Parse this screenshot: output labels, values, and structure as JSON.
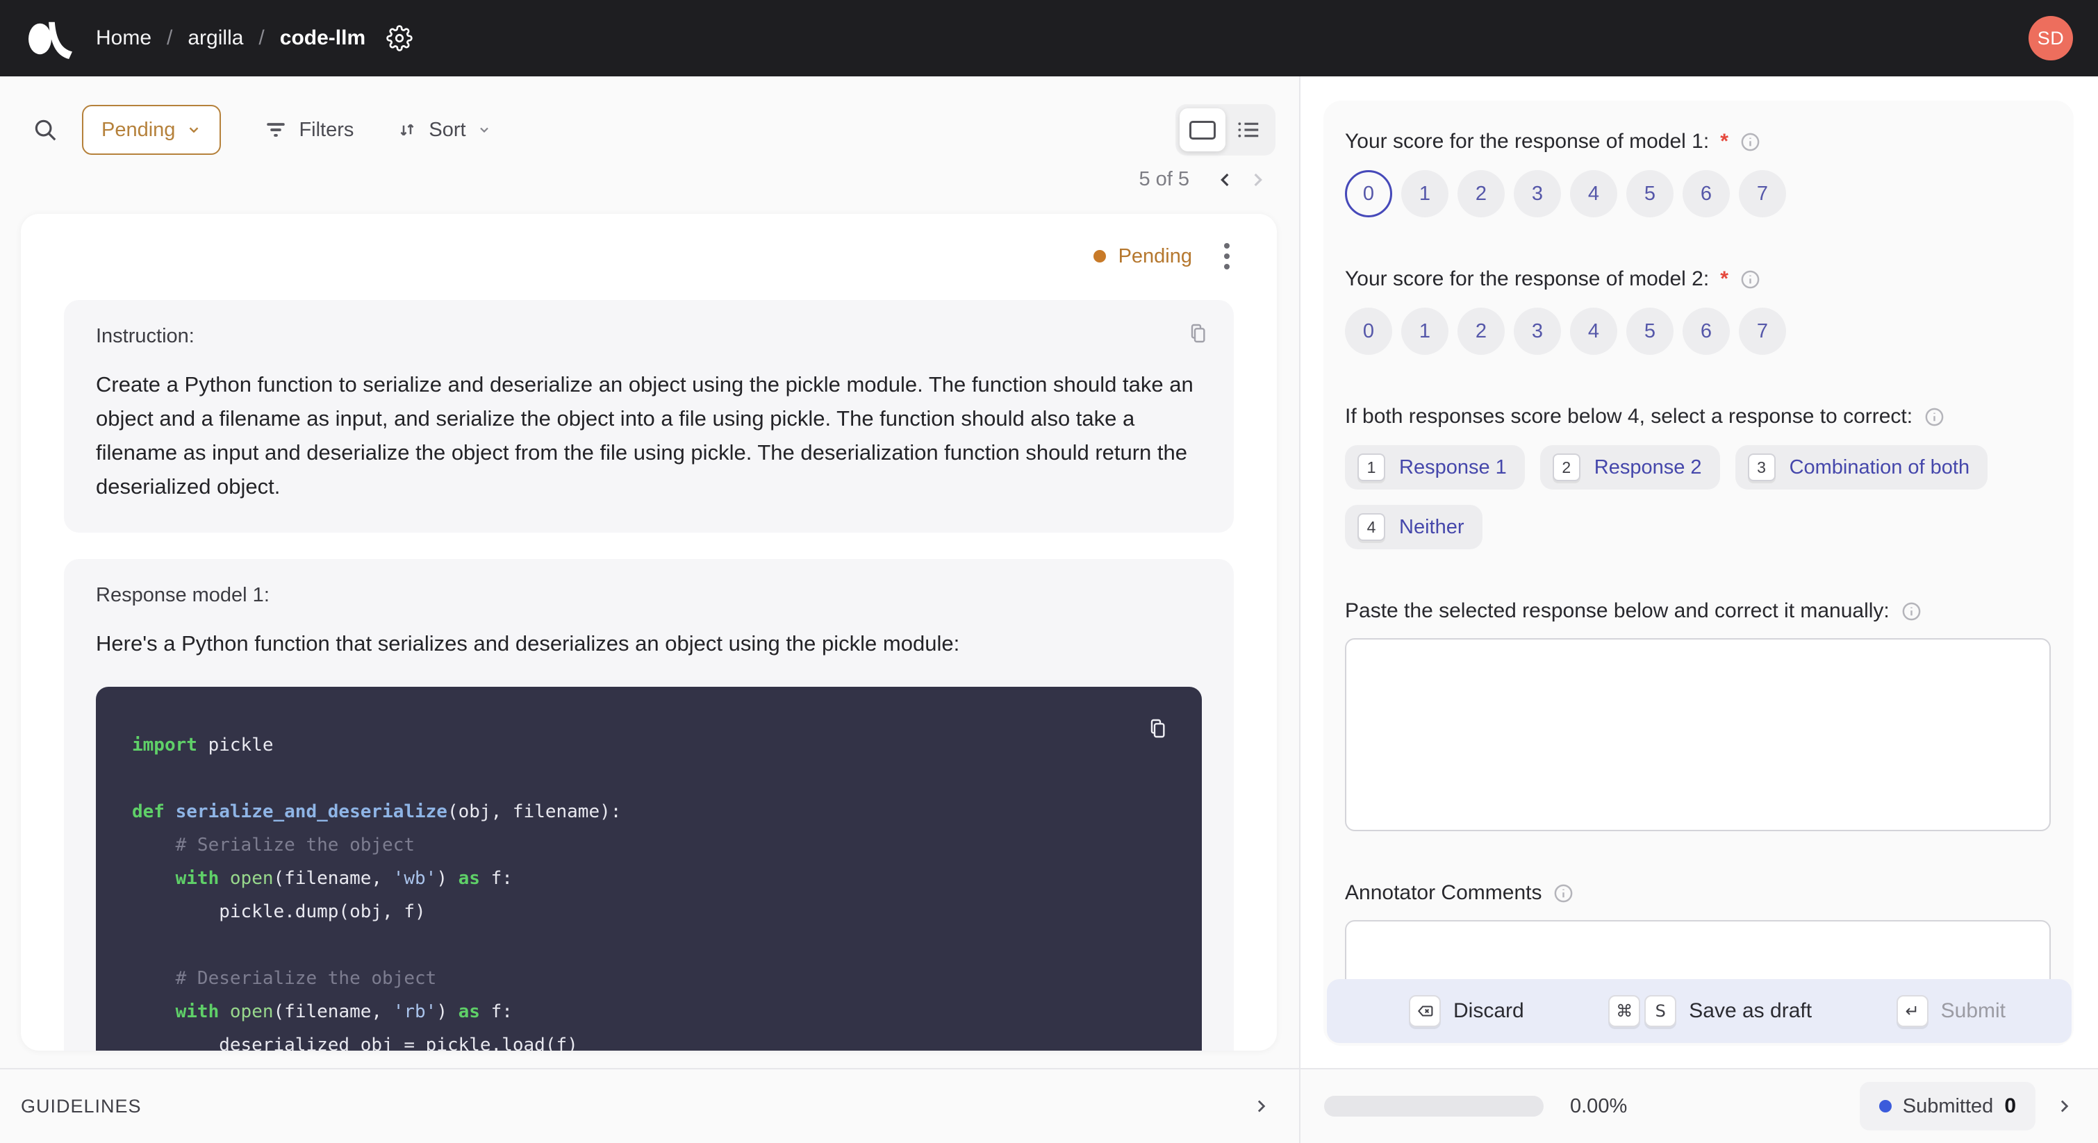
{
  "nav": {
    "breadcrumb": [
      {
        "label": "Home"
      },
      {
        "label": "argilla"
      },
      {
        "label": "code-llm"
      }
    ],
    "separator": "/",
    "avatar_initials": "SD"
  },
  "toolbar": {
    "status_filter_label": "Pending",
    "filters_label": "Filters",
    "sort_label": "Sort",
    "pagination": "5 of 5"
  },
  "record": {
    "status_label": "Pending",
    "instruction": {
      "title": "Instruction:",
      "text": "Create a Python function to serialize and deserialize an object using the pickle module. The function should take an object and a filename as input, and serialize the object into a file using pickle. The function should also take a filename as input and deserialize the object from the file using pickle. The deserialization function should return the deserialized object."
    },
    "response": {
      "title": "Response model 1:",
      "intro": "Here's a Python function that serializes and deserializes an object using the pickle module:"
    },
    "code_lines": [
      [
        {
          "t": "import",
          "c": "kw"
        },
        {
          "t": " pickle",
          "c": "pl"
        }
      ],
      [],
      [
        {
          "t": "def",
          "c": "kw"
        },
        {
          "t": " ",
          "c": "pl"
        },
        {
          "t": "serialize_and_deserialize",
          "c": "fn"
        },
        {
          "t": "(obj, filename):",
          "c": "pl"
        }
      ],
      [
        {
          "t": "    ",
          "c": "pl"
        },
        {
          "t": "# Serialize the object",
          "c": "cm"
        }
      ],
      [
        {
          "t": "    ",
          "c": "pl"
        },
        {
          "t": "with",
          "c": "kw"
        },
        {
          "t": " ",
          "c": "pl"
        },
        {
          "t": "open",
          "c": "bi"
        },
        {
          "t": "(filename, ",
          "c": "pl"
        },
        {
          "t": "'wb'",
          "c": "st"
        },
        {
          "t": ") ",
          "c": "pl"
        },
        {
          "t": "as",
          "c": "kw"
        },
        {
          "t": " f:",
          "c": "pl"
        }
      ],
      [
        {
          "t": "        pickle.dump(obj, f)",
          "c": "pl"
        }
      ],
      [],
      [
        {
          "t": "    ",
          "c": "pl"
        },
        {
          "t": "# Deserialize the object",
          "c": "cm"
        }
      ],
      [
        {
          "t": "    ",
          "c": "pl"
        },
        {
          "t": "with",
          "c": "kw"
        },
        {
          "t": " ",
          "c": "pl"
        },
        {
          "t": "open",
          "c": "bi"
        },
        {
          "t": "(filename, ",
          "c": "pl"
        },
        {
          "t": "'rb'",
          "c": "st"
        },
        {
          "t": ") ",
          "c": "pl"
        },
        {
          "t": "as",
          "c": "kw"
        },
        {
          "t": " f:",
          "c": "pl"
        }
      ],
      [
        {
          "t": "        deserialized_obj = pickle.load(f)",
          "c": "pl"
        }
      ]
    ]
  },
  "questions": {
    "q1": {
      "label": "Your score for the response of model 1:",
      "required_marker": "*",
      "options": [
        "0",
        "1",
        "2",
        "3",
        "4",
        "5",
        "6",
        "7"
      ],
      "selected": "0"
    },
    "q2": {
      "label": "Your score for the response of model 2:",
      "required_marker": "*",
      "options": [
        "0",
        "1",
        "2",
        "3",
        "4",
        "5",
        "6",
        "7"
      ],
      "selected": null
    },
    "q3": {
      "label": "If both responses score below 4, select a response to correct:",
      "options": [
        {
          "key": "1",
          "label": "Response 1"
        },
        {
          "key": "2",
          "label": "Response 2"
        },
        {
          "key": "3",
          "label": "Combination of both"
        },
        {
          "key": "4",
          "label": "Neither"
        }
      ]
    },
    "q4": {
      "label": "Paste the selected response below and correct it manually:",
      "value": ""
    },
    "q5": {
      "label": "Annotator Comments",
      "value": ""
    }
  },
  "actions": {
    "discard": {
      "label": "Discard"
    },
    "save_draft": {
      "label": "Save as draft",
      "keys": [
        "⌘",
        "S"
      ]
    },
    "submit": {
      "label": "Submit",
      "key": "↵",
      "disabled": true
    }
  },
  "footer": {
    "guidelines_label": "GUIDELINES",
    "progress_percent": "0.00%",
    "submitted_label": "Submitted",
    "submitted_count": "0"
  },
  "colors": {
    "accent_amber": "#b5813b",
    "status_pending_text": "#b5772e",
    "status_pending_dot": "#c87a28",
    "indigo_text": "#5557a9",
    "selected_ring": "#4649b9",
    "code_bg": "#333347",
    "code_keyword": "#5fd068",
    "code_function": "#8fb5e6",
    "code_builtin": "#98d88c",
    "code_string": "#aac4ec",
    "code_comment": "#7d7d90",
    "avatar_bg": "#ed6e5d",
    "submitted_dot": "#3b5bdb",
    "action_bar_bg": "#e9ecf8"
  }
}
